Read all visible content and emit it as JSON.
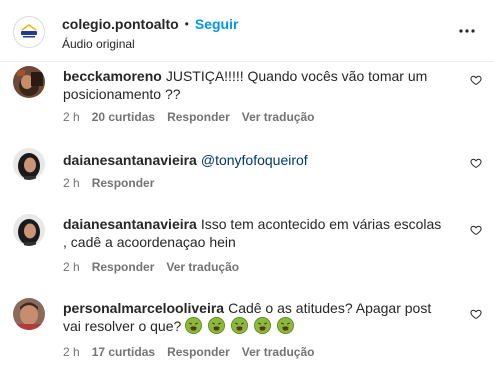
{
  "header": {
    "username": "colegio.pontoalto",
    "separator": "•",
    "follow_label": "Seguir",
    "subtitle": "Áudio original",
    "avatar_icon": "colegio-logo-icon",
    "more_icon": "more-options-icon"
  },
  "comments": [
    {
      "username": "becckamoreno",
      "text": "JUSTIÇA!!!!! Quando vocês vão tomar um posicionamento ??",
      "time": "2 h",
      "likes": "20 curtidas",
      "reply_label": "Responder",
      "translate_label": "Ver tradução"
    },
    {
      "username": "daianesantanavieira",
      "mention": "@tonyfofoqueirof",
      "time": "2 h",
      "reply_label": "Responder"
    },
    {
      "username": "daianesantanavieira",
      "text": "Isso tem acontecido em várias escolas , cadê a acoordenaçao hein",
      "time": "2 h",
      "reply_label": "Responder",
      "translate_label": "Ver tradução"
    },
    {
      "username": "personalmarceloolivei​ra",
      "text": "Cadê o as atitudes? Apagar post vai resolver o que?",
      "emoji_count": 5,
      "emoji_icon": "nauseated-face-icon",
      "time": "2 h",
      "likes": "17 curtidas",
      "reply_label": "Responder",
      "translate_label": "Ver tradução"
    }
  ],
  "colors": {
    "link_blue": "#0095f6",
    "mention_blue": "#00376b",
    "meta_gray": "#737373",
    "text": "#262626"
  }
}
